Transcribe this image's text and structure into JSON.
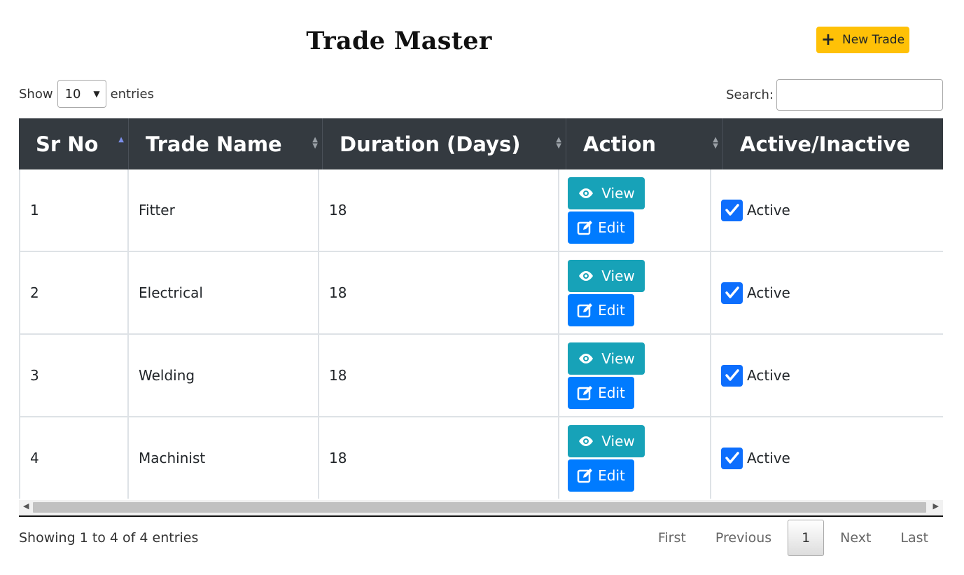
{
  "title": "Trade Master",
  "new_button": {
    "label": "New Trade",
    "icon": "plus-icon",
    "color": "#ffc107"
  },
  "length": {
    "prefix": "Show",
    "value": "10",
    "suffix": "entries"
  },
  "search": {
    "label": "Search:",
    "value": ""
  },
  "columns": [
    "Sr No",
    "Trade Name",
    "Duration (Days)",
    "Action",
    "Active/Inactive"
  ],
  "rows": [
    {
      "sr": "1",
      "name": "Fitter",
      "duration": "18",
      "view": "View",
      "edit": "Edit",
      "status": "Active",
      "checked": true
    },
    {
      "sr": "2",
      "name": "Electrical",
      "duration": "18",
      "view": "View",
      "edit": "Edit",
      "status": "Active",
      "checked": true
    },
    {
      "sr": "3",
      "name": "Welding",
      "duration": "18",
      "view": "View",
      "edit": "Edit",
      "status": "Active",
      "checked": true
    },
    {
      "sr": "4",
      "name": "Machinist",
      "duration": "18",
      "view": "View",
      "edit": "Edit",
      "status": "Active",
      "checked": true
    }
  ],
  "info": "Showing 1 to 4 of 4 entries",
  "pagination": {
    "first": "First",
    "previous": "Previous",
    "current": "1",
    "next": "Next",
    "last": "Last"
  },
  "colors": {
    "header_bg": "#343a40",
    "view_btn": "#17a2b8",
    "edit_btn": "#007bff",
    "checkbox": "#0d6efd"
  }
}
